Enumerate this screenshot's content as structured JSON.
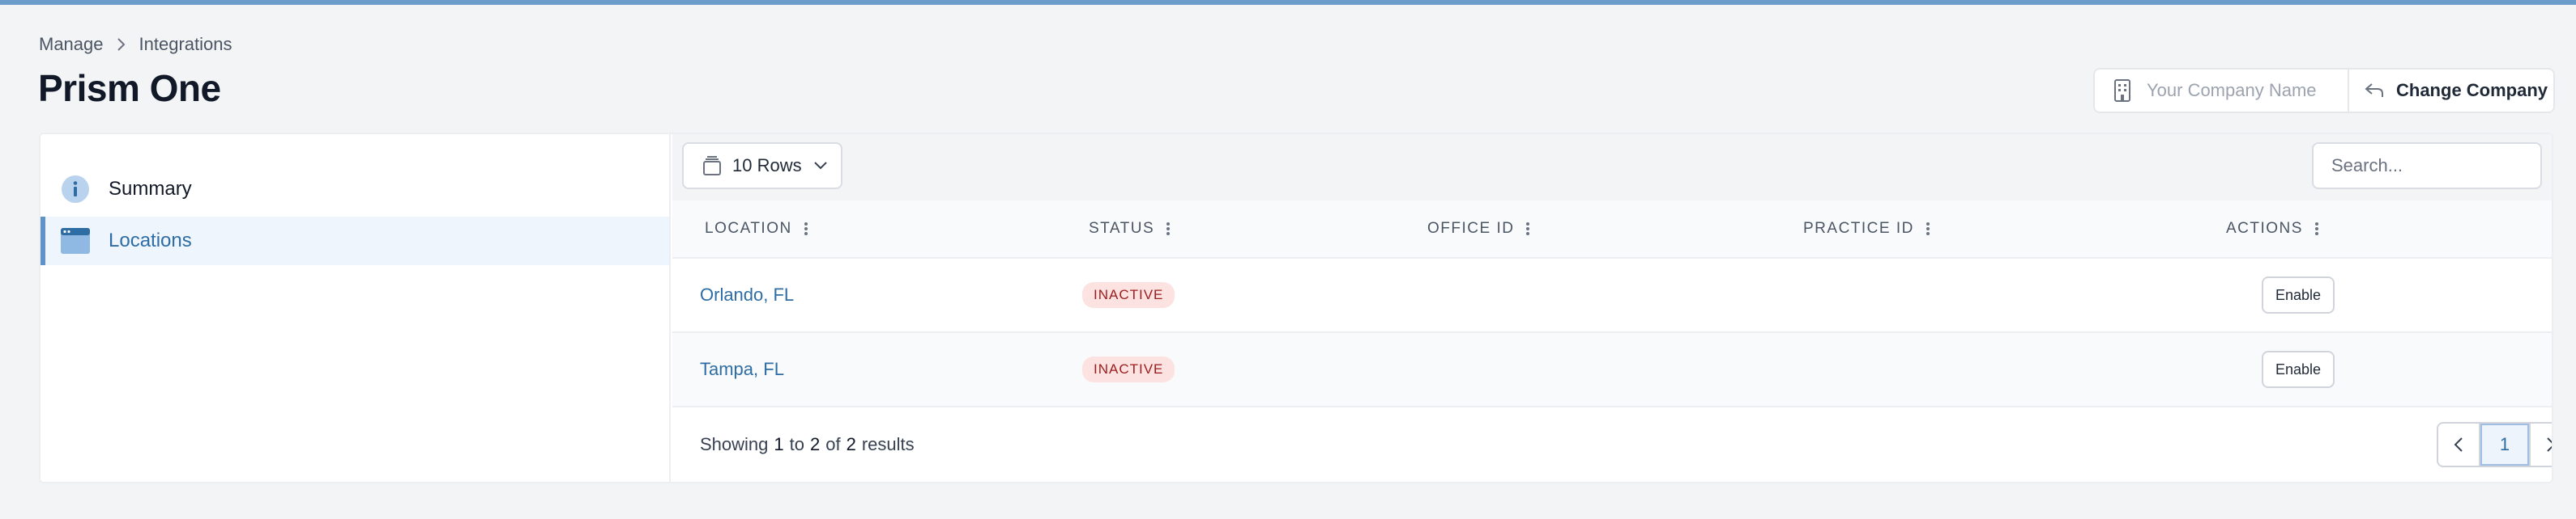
{
  "breadcrumb": {
    "items": [
      "Manage",
      "Integrations"
    ]
  },
  "page": {
    "title": "Prism One"
  },
  "company": {
    "placeholder": "Your Company Name",
    "change_label": "Change Company"
  },
  "sidebar": {
    "items": [
      {
        "label": "Summary"
      },
      {
        "label": "Locations"
      }
    ]
  },
  "toolbar": {
    "rows_label": "10 Rows",
    "search_placeholder": "Search..."
  },
  "table": {
    "columns": [
      "LOCATION",
      "STATUS",
      "OFFICE ID",
      "PRACTICE ID",
      "ACTIONS"
    ],
    "rows": [
      {
        "location": "Orlando, FL",
        "status": "INACTIVE",
        "office_id": "",
        "practice_id": "",
        "action": "Enable"
      },
      {
        "location": "Tampa, FL",
        "status": "INACTIVE",
        "office_id": "",
        "practice_id": "",
        "action": "Enable"
      }
    ]
  },
  "footer": {
    "prefix": "Showing",
    "from": "1",
    "to_word": "to",
    "to": "2",
    "of_word": "of",
    "total": "2",
    "suffix": "results"
  },
  "pagination": {
    "current": "1"
  },
  "colors": {
    "accent": "#6b9ccc",
    "link": "#2e6da4",
    "badge_bg": "#fde2e2",
    "badge_text": "#9b1c1c"
  },
  "icons": [
    "chevron-right-icon",
    "building-icon",
    "switch-arrow-icon",
    "info-icon",
    "window-icon",
    "stack-icon",
    "chevron-down-icon",
    "kebab-icon",
    "chevron-left-icon"
  ]
}
